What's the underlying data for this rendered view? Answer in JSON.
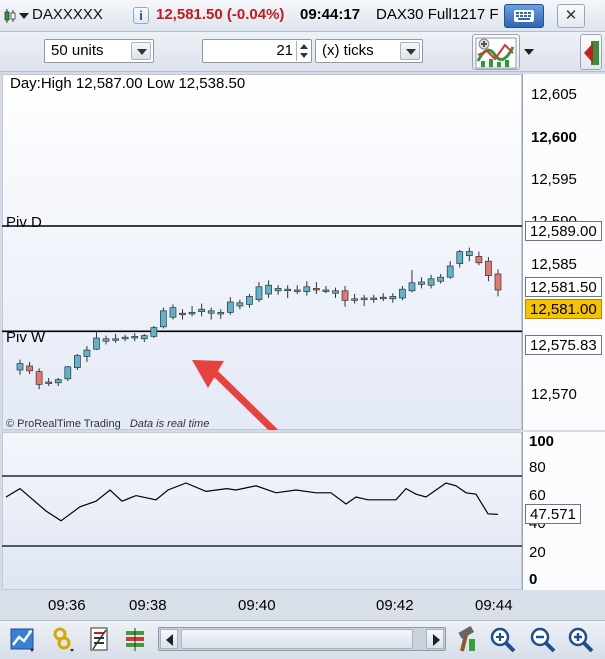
{
  "window": {
    "symbol": "DAXXXXX",
    "info_glyph": "i",
    "price_change": "12,581.50 (-0.04%)",
    "time": "09:44:17",
    "instrument": "DAX30 Full1217 F",
    "close_glyph": "✕"
  },
  "toolbar": {
    "units": "50 units",
    "ticks_value": "21",
    "ticks_mode": "(x) ticks"
  },
  "price_chart": {
    "day_range": "Day:High 12,587.00 Low 12,538.50",
    "watermark": "© ProRealTime Trading",
    "realtime_note": "Data is real time",
    "lines": [
      {
        "name": "Piv D",
        "value": 12589.0,
        "label": "12,589.00"
      },
      {
        "name": "Piv W",
        "value": 12575.83,
        "label": "12,575.83"
      }
    ],
    "price_tags": {
      "last": "12,581.50",
      "current": "12,581.00"
    },
    "scale_labels": [
      "12,605",
      "12,600",
      "12,595",
      "12,590",
      "12,585",
      "12,570"
    ],
    "colors": {
      "up": "#5fb4c8",
      "down": "#e07a6e",
      "current_tag": "#f5c400",
      "arrow": "#e8423f"
    }
  },
  "indicator": {
    "scale_labels": [
      "100",
      "80",
      "60",
      "40",
      "20",
      "0"
    ],
    "levels": [
      75,
      25
    ],
    "value_label": "47.571"
  },
  "time_axis": [
    "09:36",
    "09:38",
    "09:40",
    "09:42",
    "09:44"
  ],
  "chart_data": {
    "type": "candlestick",
    "candles": [
      {
        "o": 12571.0,
        "h": 12572.3,
        "l": 12570.4,
        "c": 12571.8
      },
      {
        "o": 12571.5,
        "h": 12572.0,
        "l": 12570.5,
        "c": 12570.9
      },
      {
        "o": 12570.8,
        "h": 12571.2,
        "l": 12568.6,
        "c": 12569.2
      },
      {
        "o": 12569.5,
        "h": 12570.0,
        "l": 12569.0,
        "c": 12569.3
      },
      {
        "o": 12569.4,
        "h": 12570.0,
        "l": 12569.0,
        "c": 12569.8
      },
      {
        "o": 12569.9,
        "h": 12571.5,
        "l": 12569.6,
        "c": 12571.4
      },
      {
        "o": 12571.3,
        "h": 12573.0,
        "l": 12571.0,
        "c": 12572.8
      },
      {
        "o": 12572.7,
        "h": 12574.0,
        "l": 12572.0,
        "c": 12573.5
      },
      {
        "o": 12573.6,
        "h": 12575.8,
        "l": 12573.5,
        "c": 12575.0
      },
      {
        "o": 12574.6,
        "h": 12575.3,
        "l": 12574.2,
        "c": 12574.9
      },
      {
        "o": 12574.8,
        "h": 12575.5,
        "l": 12574.4,
        "c": 12574.9
      },
      {
        "o": 12574.9,
        "h": 12575.4,
        "l": 12574.6,
        "c": 12575.1
      },
      {
        "o": 12575.0,
        "h": 12575.6,
        "l": 12574.6,
        "c": 12575.2
      },
      {
        "o": 12574.9,
        "h": 12575.5,
        "l": 12574.5,
        "c": 12575.3
      },
      {
        "o": 12575.2,
        "h": 12576.5,
        "l": 12575.0,
        "c": 12576.3
      },
      {
        "o": 12576.4,
        "h": 12578.8,
        "l": 12576.2,
        "c": 12578.4
      },
      {
        "o": 12577.6,
        "h": 12579.2,
        "l": 12577.3,
        "c": 12578.8
      },
      {
        "o": 12578.1,
        "h": 12578.6,
        "l": 12577.3,
        "c": 12578.0
      },
      {
        "o": 12578.1,
        "h": 12579.0,
        "l": 12577.7,
        "c": 12578.2
      },
      {
        "o": 12578.3,
        "h": 12579.3,
        "l": 12577.7,
        "c": 12578.6
      },
      {
        "o": 12578.1,
        "h": 12578.8,
        "l": 12577.3,
        "c": 12578.4
      },
      {
        "o": 12578.0,
        "h": 12578.6,
        "l": 12577.4,
        "c": 12578.2
      },
      {
        "o": 12578.2,
        "h": 12580.1,
        "l": 12577.9,
        "c": 12579.5
      },
      {
        "o": 12579.0,
        "h": 12579.8,
        "l": 12578.6,
        "c": 12579.4
      },
      {
        "o": 12579.2,
        "h": 12580.5,
        "l": 12578.8,
        "c": 12580.2
      },
      {
        "o": 12579.8,
        "h": 12582.0,
        "l": 12579.5,
        "c": 12581.4
      },
      {
        "o": 12580.5,
        "h": 12582.2,
        "l": 12580.0,
        "c": 12581.6
      },
      {
        "o": 12580.9,
        "h": 12581.6,
        "l": 12580.4,
        "c": 12581.2
      },
      {
        "o": 12581.0,
        "h": 12581.6,
        "l": 12580.0,
        "c": 12581.1
      },
      {
        "o": 12581.0,
        "h": 12581.6,
        "l": 12580.5,
        "c": 12581.0
      },
      {
        "o": 12580.8,
        "h": 12582.1,
        "l": 12580.3,
        "c": 12581.4
      },
      {
        "o": 12581.2,
        "h": 12582.0,
        "l": 12580.5,
        "c": 12581.0
      },
      {
        "o": 12581.0,
        "h": 12581.5,
        "l": 12580.6,
        "c": 12581.0
      },
      {
        "o": 12580.6,
        "h": 12581.3,
        "l": 12580.0,
        "c": 12580.9
      },
      {
        "o": 12580.9,
        "h": 12581.5,
        "l": 12578.9,
        "c": 12579.7
      },
      {
        "o": 12579.7,
        "h": 12580.5,
        "l": 12579.3,
        "c": 12579.9
      },
      {
        "o": 12579.8,
        "h": 12580.4,
        "l": 12579.0,
        "c": 12580.0
      },
      {
        "o": 12579.8,
        "h": 12580.4,
        "l": 12579.4,
        "c": 12580.0
      },
      {
        "o": 12580.1,
        "h": 12580.6,
        "l": 12579.6,
        "c": 12580.0
      },
      {
        "o": 12579.9,
        "h": 12580.6,
        "l": 12579.4,
        "c": 12580.2
      },
      {
        "o": 12580.0,
        "h": 12581.5,
        "l": 12579.7,
        "c": 12581.1
      },
      {
        "o": 12580.9,
        "h": 12583.5,
        "l": 12580.7,
        "c": 12581.9
      },
      {
        "o": 12581.7,
        "h": 12582.6,
        "l": 12581.2,
        "c": 12582.0
      },
      {
        "o": 12581.6,
        "h": 12582.9,
        "l": 12581.2,
        "c": 12582.4
      },
      {
        "o": 12582.1,
        "h": 12583.0,
        "l": 12581.8,
        "c": 12582.6
      },
      {
        "o": 12582.6,
        "h": 12584.6,
        "l": 12582.4,
        "c": 12584.0
      },
      {
        "o": 12584.3,
        "h": 12586.0,
        "l": 12583.8,
        "c": 12585.8
      },
      {
        "o": 12585.3,
        "h": 12586.3,
        "l": 12584.6,
        "c": 12585.8
      },
      {
        "o": 12585.2,
        "h": 12585.8,
        "l": 12584.1,
        "c": 12584.4
      },
      {
        "o": 12584.6,
        "h": 12585.1,
        "l": 12582.1,
        "c": 12582.8
      },
      {
        "o": 12583.0,
        "h": 12583.6,
        "l": 12580.2,
        "c": 12581.0
      }
    ],
    "oscillator": [
      {
        "x": 0,
        "y": 60
      },
      {
        "x": 14,
        "y": 66
      },
      {
        "x": 40,
        "y": 50
      },
      {
        "x": 55,
        "y": 43
      },
      {
        "x": 74,
        "y": 53
      },
      {
        "x": 90,
        "y": 57
      },
      {
        "x": 104,
        "y": 65
      },
      {
        "x": 116,
        "y": 57
      },
      {
        "x": 130,
        "y": 61
      },
      {
        "x": 150,
        "y": 58
      },
      {
        "x": 162,
        "y": 65
      },
      {
        "x": 180,
        "y": 70
      },
      {
        "x": 200,
        "y": 64
      },
      {
        "x": 221,
        "y": 66
      },
      {
        "x": 230,
        "y": 65
      },
      {
        "x": 250,
        "y": 68
      },
      {
        "x": 270,
        "y": 63
      },
      {
        "x": 290,
        "y": 65
      },
      {
        "x": 310,
        "y": 63
      },
      {
        "x": 325,
        "y": 63
      },
      {
        "x": 340,
        "y": 55
      },
      {
        "x": 350,
        "y": 60
      },
      {
        "x": 362,
        "y": 58
      },
      {
        "x": 390,
        "y": 58
      },
      {
        "x": 400,
        "y": 66
      },
      {
        "x": 410,
        "y": 62
      },
      {
        "x": 420,
        "y": 60
      },
      {
        "x": 440,
        "y": 70
      },
      {
        "x": 450,
        "y": 68
      },
      {
        "x": 460,
        "y": 63
      },
      {
        "x": 470,
        "y": 62
      },
      {
        "x": 482,
        "y": 48
      },
      {
        "x": 492,
        "y": 47.6
      }
    ],
    "y_range": [
      12566,
      12607
    ],
    "osc_range": [
      -5,
      105
    ]
  }
}
